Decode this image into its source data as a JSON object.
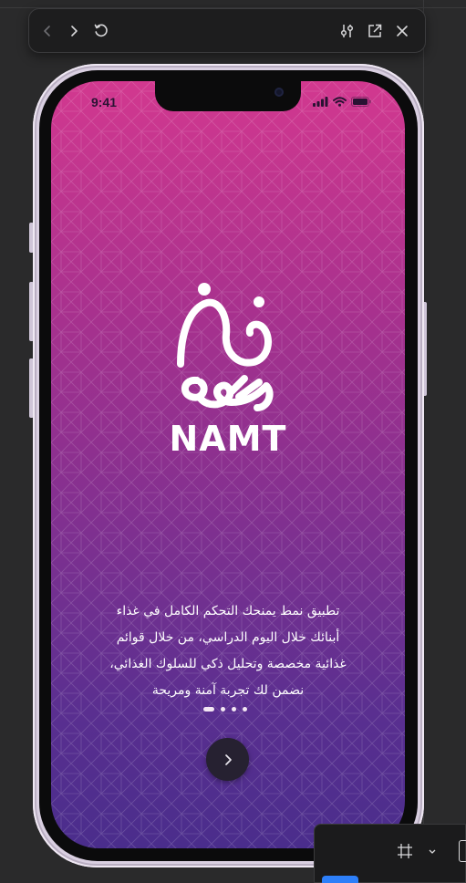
{
  "toolbar": {
    "back_icon": "chevron-left-icon",
    "forward_icon": "chevron-right-icon",
    "reload_icon": "reload-icon",
    "settings_icon": "sliders-icon",
    "open_icon": "open-external-icon",
    "close_icon": "close-icon"
  },
  "status_bar": {
    "time": "9:41"
  },
  "splash": {
    "brand": "NAMT",
    "description_lines": [
      "تطبيق نمط يمنحك التحكم الكامل في غذاء",
      "أبنائك خلال اليوم الدراسي، من خلال قوائم",
      "غذائية مخصصة وتحليل ذكي للسلوك الغذائي،",
      "نضمن لك تجربة آمنة ومريحة"
    ],
    "pagination": {
      "total": 4,
      "active_index": 0
    },
    "next_icon": "chevron-right-icon"
  },
  "colors": {
    "gradient_top": "#d2388f",
    "gradient_bottom": "#4a2d8c",
    "button_bg": "#262131",
    "toolbar_bg": "#1d1d1e"
  }
}
